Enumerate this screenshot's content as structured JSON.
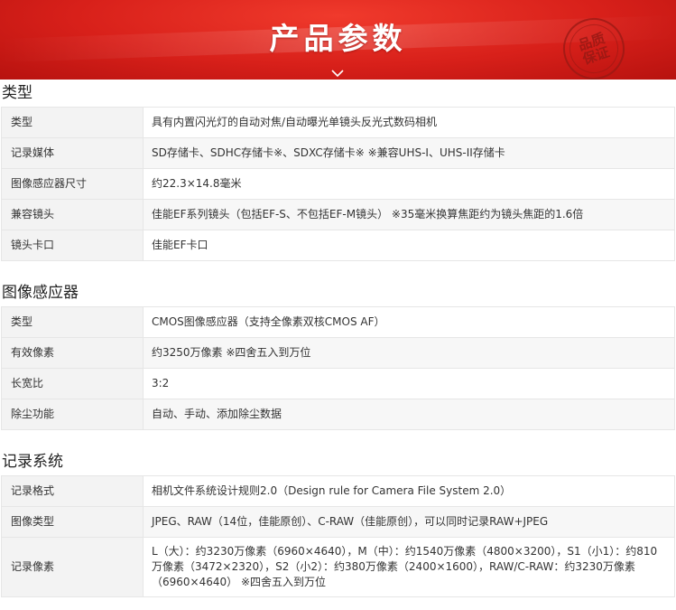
{
  "banner": {
    "title": "产品参数",
    "stamp_line1": "品质",
    "stamp_line2": "保证",
    "accent_color": "#d8201a"
  },
  "sections": [
    {
      "title": "类型",
      "rows": [
        {
          "label": "类型",
          "value": "具有内置闪光灯的自动对焦/自动曝光单镜头反光式数码相机"
        },
        {
          "label": "记录媒体",
          "value": "SD存储卡、SDHC存储卡※、SDXC存储卡※ ※兼容UHS-I、UHS-II存储卡"
        },
        {
          "label": "图像感应器尺寸",
          "value": "约22.3×14.8毫米"
        },
        {
          "label": "兼容镜头",
          "value": "佳能EF系列镜头（包括EF-S、不包括EF-M镜头） ※35毫米换算焦距约为镜头焦距的1.6倍"
        },
        {
          "label": "镜头卡口",
          "value": "佳能EF卡口"
        }
      ]
    },
    {
      "title": "图像感应器",
      "rows": [
        {
          "label": "类型",
          "value": "CMOS图像感应器（支持全像素双核CMOS AF）"
        },
        {
          "label": "有效像素",
          "value": "约3250万像素 ※四舍五入到万位"
        },
        {
          "label": "长宽比",
          "value": "3:2"
        },
        {
          "label": "除尘功能",
          "value": "自动、手动、添加除尘数据"
        }
      ]
    },
    {
      "title": "记录系统",
      "rows": [
        {
          "label": "记录格式",
          "value": "相机文件系统设计规则2.0（Design rule for Camera File System 2.0）"
        },
        {
          "label": "图像类型",
          "value": "JPEG、RAW（14位，佳能原创）、C-RAW（佳能原创），可以同时记录RAW+JPEG"
        },
        {
          "label": "记录像素",
          "value": "L（大）：约3230万像素（6960×4640），M（中）：约1540万像素（4800×3200），S1（小1）：约810万像素（3472×2320），S2（小2）：约380万像素（2400×1600），RAW/C-RAW：约3230万像素（6960×4640） ※四舍五入到万位"
        }
      ]
    }
  ]
}
